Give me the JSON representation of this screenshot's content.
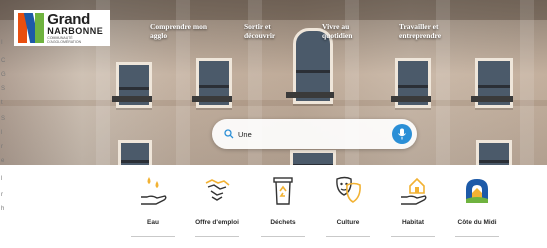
{
  "brand": {
    "name_line1": "Grand",
    "name_line2": "NARBONNE",
    "tagline": "COMMUNAUTÉ D'AGGLOMÉRATION"
  },
  "nav": [
    {
      "label_line1": "Comprendre mon",
      "label_line2": "agglo"
    },
    {
      "label_line1": "Sortir et",
      "label_line2": "découvrir"
    },
    {
      "label_line1": "Vivre au",
      "label_line2": "quotidien"
    },
    {
      "label_line1": "Travailler et",
      "label_line2": "entreprendre"
    }
  ],
  "search": {
    "value": "Une",
    "placeholder": "Une"
  },
  "edge_glyphs": [
    "I",
    "C",
    "G",
    "S",
    "t",
    "S",
    "l",
    "r",
    "e",
    "l",
    "r",
    "h"
  ],
  "quick_links": [
    {
      "label": "Eau",
      "icon": "water-hand-icon"
    },
    {
      "label": "Offre d'emploi",
      "icon": "handshake-icon"
    },
    {
      "label": "Déchets",
      "icon": "recycling-bin-icon"
    },
    {
      "label": "Culture",
      "icon": "theater-masks-icon"
    },
    {
      "label": "Habitat",
      "icon": "house-hand-icon"
    },
    {
      "label": "Côte du Midi",
      "icon": "cote-du-midi-logo-icon"
    }
  ],
  "colors": {
    "accent_yellow": "#f2b233",
    "mic_blue": "#2b8fd6",
    "logo_orange": "#e84e0f",
    "logo_blue": "#1d5aa8",
    "logo_green": "#6fb33f"
  }
}
